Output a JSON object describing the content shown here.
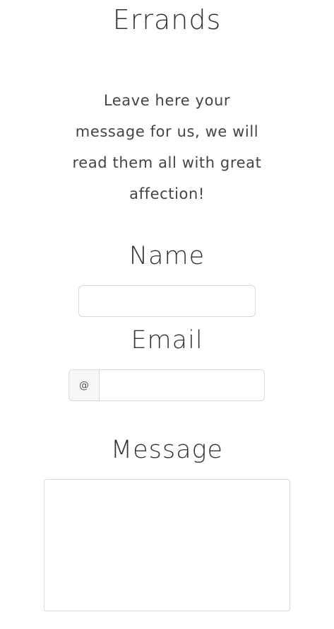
{
  "page": {
    "title": "Errands",
    "intro": "Leave here your message for us, we will read them all with great affection!"
  },
  "form": {
    "name": {
      "label": "Name",
      "value": "",
      "placeholder": ""
    },
    "email": {
      "label": "Email",
      "prefix": "@",
      "value": "",
      "placeholder": ""
    },
    "message": {
      "label": "Message",
      "value": "",
      "placeholder": ""
    }
  }
}
